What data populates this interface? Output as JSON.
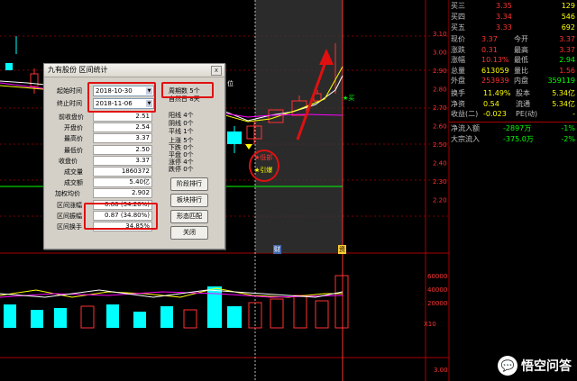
{
  "dialog": {
    "title": "九有股份 区间统计",
    "close": "x",
    "start_label": "起始时间",
    "start_value": "2018-10-30",
    "end_label": "终止时间",
    "end_value": "2018-11-06",
    "period_label": "周期数",
    "period_value": "5个",
    "natural_days": "自然日 8天",
    "stats": [
      {
        "label": "前收盘价",
        "value": "2.51"
      },
      {
        "label": "开盘价",
        "value": "2.54"
      },
      {
        "label": "最高价",
        "value": "3.37"
      },
      {
        "label": "最低价",
        "value": "2.50"
      },
      {
        "label": "收盘价",
        "value": "3.37"
      },
      {
        "label": "成交量",
        "value": "1860372"
      },
      {
        "label": "成交额",
        "value": "5.40亿"
      },
      {
        "label": "加权均价",
        "value": "2.902"
      },
      {
        "label": "区间涨幅",
        "value": "0.86 (34.26%)"
      },
      {
        "label": "区间振幅",
        "value": "0.87 (34.80%)"
      },
      {
        "label": "区间换手",
        "value": "34.85%"
      }
    ],
    "counts": [
      "阳线 4个",
      "阴线 0个",
      "平线 1个"
    ],
    "counts2": [
      "上涨 5个",
      "下跌 0个",
      "平盘 0个",
      "涨停 4个",
      "跌停 0个"
    ],
    "buttons": [
      "阶段排行",
      "板块排行",
      "形态匹配",
      "关闭"
    ]
  },
  "axis": {
    "price_ticks": [
      "3.10",
      "3.00",
      "2.90",
      "2.80",
      "2.70",
      "2.60",
      "2.50",
      "2.40",
      "2.30",
      "2.20"
    ],
    "vol_ticks": [
      "60000",
      "40000",
      "20000"
    ],
    "vol_unit": "X10",
    "bottom_tick": "3.00"
  },
  "markers": {
    "low_label": "低部",
    "boom_label": "引爆",
    "buy_label": "买",
    "cai_label": "财",
    "zi_label": "资",
    "pos_label": "位"
  },
  "quote": {
    "asks": [
      {
        "label": "买三",
        "price": "3.35",
        "vol": "129"
      },
      {
        "label": "买四",
        "price": "3.34",
        "vol": "546"
      },
      {
        "label": "买五",
        "price": "3.33",
        "vol": "692"
      }
    ],
    "rows": [
      {
        "l1": "现价",
        "v1": "3.37",
        "l2": "今开",
        "v2": "3.37"
      },
      {
        "l1": "涨跌",
        "v1": "0.31",
        "l2": "最高",
        "v2": "3.37"
      },
      {
        "l1": "涨幅",
        "v1": "10.13%",
        "l2": "最低",
        "v2": "2.94"
      },
      {
        "l1": "总量",
        "v1": "613059",
        "l2": "量比",
        "v2": "1.56"
      },
      {
        "l1": "外盘",
        "v1": "253939",
        "l2": "内盘",
        "v2": "359119"
      }
    ],
    "rows2": [
      {
        "l1": "换手",
        "v1": "11.49%",
        "l2": "股本",
        "v2": "5.34亿"
      },
      {
        "l1": "净资",
        "v1": "0.54",
        "l2": "流通",
        "v2": "5.34亿"
      },
      {
        "l1": "收益(二)",
        "v1": "-0.023",
        "l2": "PE(动)",
        "v2": "-"
      }
    ],
    "flows": [
      {
        "label": "净流入额",
        "value": "-2897万",
        "pct": "-1%"
      },
      {
        "label": "大宗流入",
        "value": "-375.0万",
        "pct": "-2%"
      }
    ]
  },
  "watermark": "悟空问答",
  "colors": {
    "up": "#ff3232",
    "down": "#00ffff",
    "ma5": "#ffffff",
    "ma10": "#ffff00",
    "ma20": "#ff00ff",
    "ma60": "#00ff00"
  }
}
